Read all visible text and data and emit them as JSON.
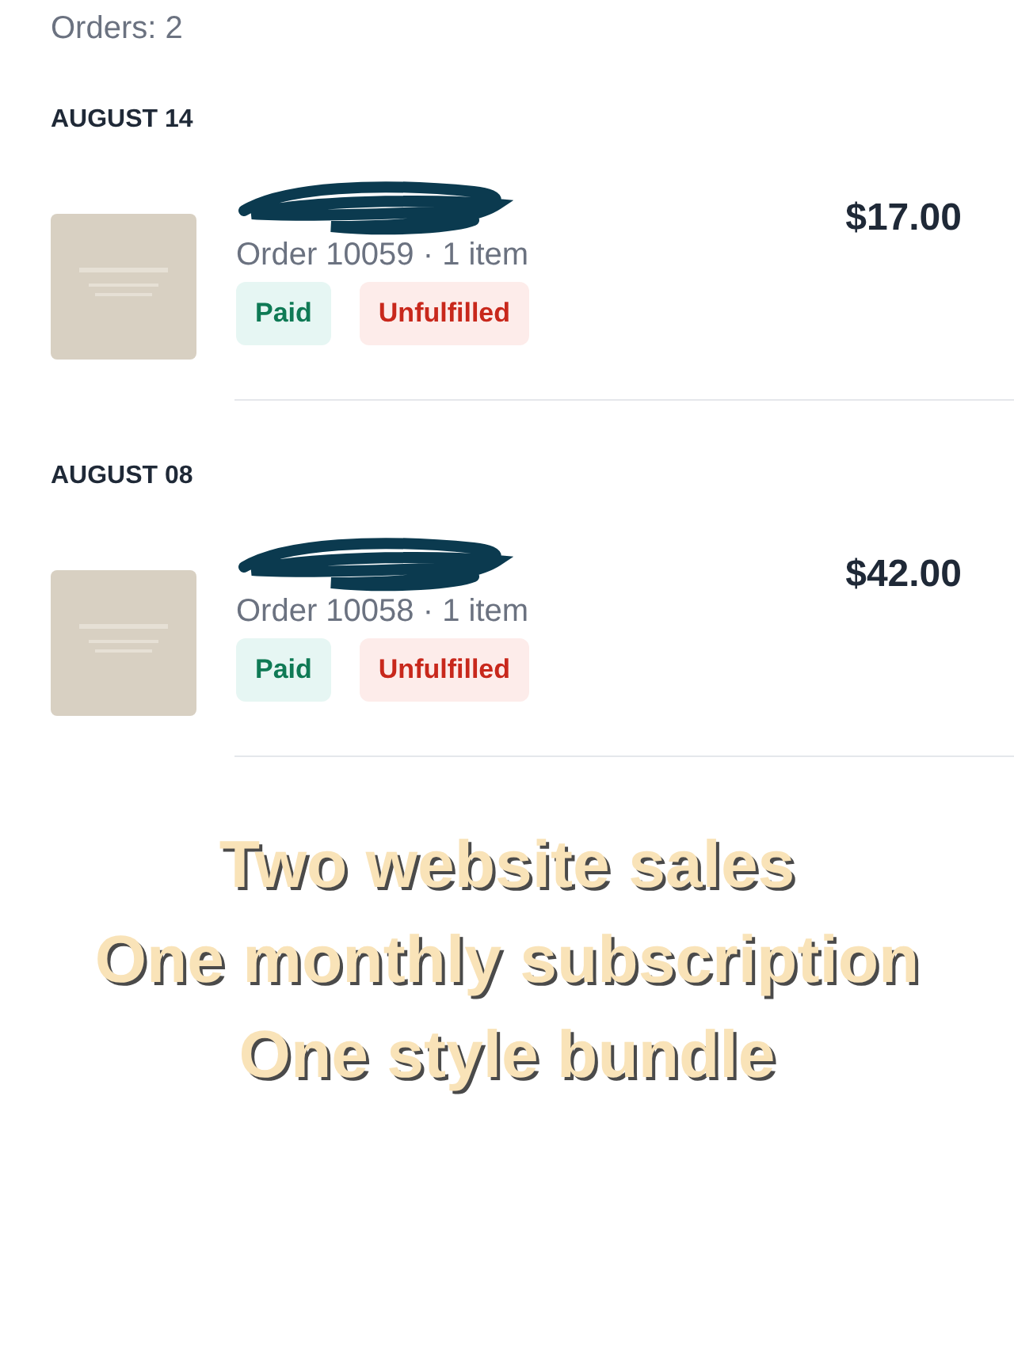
{
  "orders_count": "Orders: 2",
  "groups": [
    {
      "date": "AUGUST 14",
      "orders": [
        {
          "thumbnail": {
            "kind": "picture"
          },
          "name_redacted": true,
          "order_line": "Order 10059 · 1 item",
          "price": "$17.00",
          "badges": [
            {
              "label": "Paid",
              "kind": "paid"
            },
            {
              "label": "Unfulfilled",
              "kind": "unfulfilled"
            }
          ]
        }
      ]
    },
    {
      "date": "AUGUST 08",
      "orders": [
        {
          "thumbnail": {
            "kind": "picture"
          },
          "name_redacted": true,
          "order_line": "Order 10058 · 1 item",
          "price": "$42.00",
          "badges": [
            {
              "label": "Paid",
              "kind": "paid"
            },
            {
              "label": "Unfulfilled",
              "kind": "unfulfilled"
            }
          ]
        }
      ]
    }
  ],
  "caption": [
    "Two website sales",
    "One monthly subscription",
    "One style bundle"
  ]
}
